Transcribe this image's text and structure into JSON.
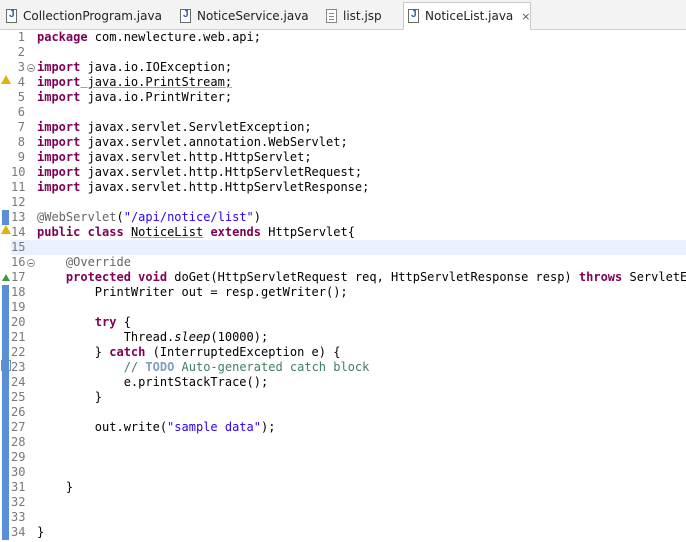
{
  "tabs": [
    {
      "label": "CollectionProgram.java",
      "icon": "java-file-icon",
      "active": false
    },
    {
      "label": "NoticeService.java",
      "icon": "java-file-icon",
      "active": false
    },
    {
      "label": "list.jsp",
      "icon": "jsp-file-icon",
      "active": false
    },
    {
      "label": "NoticeList.java",
      "icon": "java-file-icon",
      "active": true
    }
  ],
  "close_glyph": "×",
  "colors": {
    "keyword": "#7f0055",
    "string": "#2a00ff",
    "annotation": "#646464",
    "comment": "#3f7f5f",
    "current_line": "#e8f2fe"
  },
  "editor": {
    "current_line": 15,
    "lines": [
      {
        "n": "1",
        "c1": "package",
        "c2": " com.newlecture.web.api;"
      },
      {
        "n": "2"
      },
      {
        "n": "3",
        "c1": "import",
        "c2": " java.io.IOException;"
      },
      {
        "n": "4",
        "c1": "import",
        "c2": " java.io.PrintStream;"
      },
      {
        "n": "5",
        "c1": "import",
        "c2": " java.io.PrintWriter;"
      },
      {
        "n": "6"
      },
      {
        "n": "7",
        "c1": "import",
        "c2": " javax.servlet.ServletException;"
      },
      {
        "n": "8",
        "c1": "import",
        "c2": " javax.servlet.annotation.WebServlet;"
      },
      {
        "n": "9",
        "c1": "import",
        "c2": " javax.servlet.http.HttpServlet;"
      },
      {
        "n": "10",
        "c1": "import",
        "c2": " javax.servlet.http.HttpServletRequest;"
      },
      {
        "n": "11",
        "c1": "import",
        "c2": " javax.servlet.http.HttpServletResponse;"
      },
      {
        "n": "12"
      },
      {
        "n": "13",
        "c1": "@WebServlet",
        "c2": "(",
        "c3": "\"/api/notice/list\"",
        "c4": ")"
      },
      {
        "n": "14",
        "c1": "public",
        "c2": " ",
        "c3": "class",
        "c4": " ",
        "c5": "NoticeList",
        "c6": " ",
        "c7": "extends",
        "c8": " HttpServlet{"
      },
      {
        "n": "15"
      },
      {
        "n": "16",
        "c1": "    ",
        "c2": "@Override"
      },
      {
        "n": "17",
        "c1": "    ",
        "c2": "protected",
        "c3": " ",
        "c4": "void",
        "c5": " doGet(HttpServletRequest req, HttpServletResponse resp) ",
        "c6": "throws",
        "c7": " ServletExce"
      },
      {
        "n": "18",
        "c1": "        PrintWriter out = resp.getWriter();"
      },
      {
        "n": "19"
      },
      {
        "n": "20",
        "c1": "        ",
        "c2": "try",
        "c3": " {"
      },
      {
        "n": "21",
        "c1": "            Thread.",
        "c2": "sleep",
        "c3": "(10000);"
      },
      {
        "n": "22",
        "c1": "        } ",
        "c2": "catch",
        "c3": " (InterruptedException e) {"
      },
      {
        "n": "23",
        "c1": "            ",
        "c2": "// ",
        "c3": "TODO",
        "c4": " Auto-generated catch block"
      },
      {
        "n": "24",
        "c1": "            e.printStackTrace();"
      },
      {
        "n": "25",
        "c1": "        }"
      },
      {
        "n": "26"
      },
      {
        "n": "27",
        "c1": "        out.write(",
        "c2": "\"sample data\"",
        "c3": ");"
      },
      {
        "n": "28"
      },
      {
        "n": "29"
      },
      {
        "n": "30"
      },
      {
        "n": "31",
        "c1": "    }"
      },
      {
        "n": "32"
      },
      {
        "n": "33"
      },
      {
        "n": "34",
        "c1": "}"
      }
    ]
  }
}
